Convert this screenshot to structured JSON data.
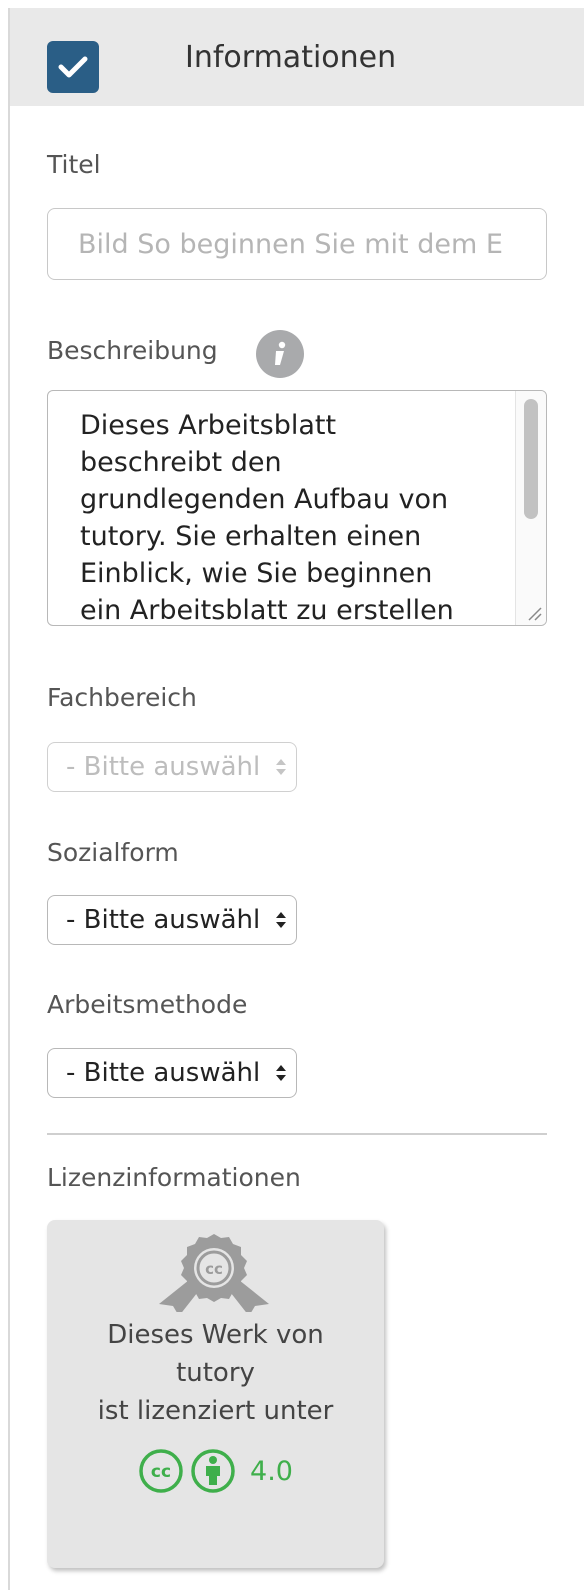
{
  "header": {
    "title": "Informationen",
    "checked": true
  },
  "titel": {
    "label": "Titel",
    "value": "Bild So beginnen Sie mit dem E"
  },
  "beschreibung": {
    "label": "Beschreibung",
    "text": "Dieses Arbeitsblatt beschreibt den grundlegenden Aufbau von tutory. Sie erhalten einen Einblick, wie Sie beginnen ein Arbeitsblatt zu erstellen"
  },
  "fachbereich": {
    "label": "Fachbereich",
    "selected": "- Bitte auswählen -",
    "disabled": true
  },
  "sozialform": {
    "label": "Sozialform",
    "selected": "- Bitte auswählen -"
  },
  "arbeitsmethode": {
    "label": "Arbeitsmethode",
    "selected": "- Bitte auswählen -"
  },
  "lizenz": {
    "label": "Lizenzinformationen",
    "line1": "Dieses Werk von",
    "line2": "tutory",
    "line3": "ist lizenziert unter",
    "version": "4.0",
    "icon": "cc-badge-icon"
  },
  "colors": {
    "accent": "#2a5e86",
    "header_bg": "#e9e9e9",
    "cc_green": "#3faf4b",
    "license_bg": "#e5e5e5"
  }
}
